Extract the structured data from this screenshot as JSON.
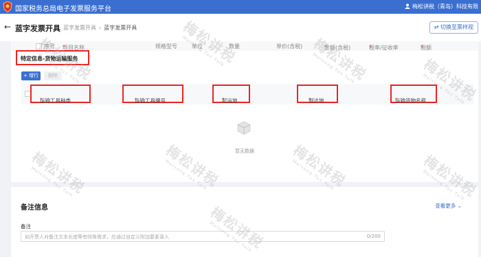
{
  "topbar": {
    "title": "国家税务总局电子发票服务平台",
    "user": "梅松讲税（青岛）科技有限"
  },
  "header": {
    "page_title": "蓝字发票开具",
    "breadcrumb": [
      "蓝字发票开具",
      "蓝字发票开具"
    ],
    "switch_button": "切换至票样视"
  },
  "table_header": {
    "columns": [
      "序号",
      "项目名称",
      "规格型号",
      "单位",
      "数量",
      "单价(含税)",
      "金额(含税)",
      "税率/征收率",
      "税额"
    ]
  },
  "special_info": {
    "title": "特定信息-货物运输服务"
  },
  "buttons": {
    "add": "+ 增行",
    "delete": "删除"
  },
  "transport_table": {
    "columns": [
      "运输工具种类",
      "运输工具牌号",
      "起运地",
      "到达地",
      "运输货物名称"
    ],
    "required_mark": "*",
    "empty_text": "暂无数据"
  },
  "remarks": {
    "title": "备注信息",
    "more": "查看更多",
    "label": "备注",
    "placeholder": "如开票人对备注文本长度等有特殊需求，应通过自定义附加要素录入",
    "counter": "0/200"
  },
  "watermark": {
    "text": "梅松讲税",
    "sub": "Meisong Tax Talk"
  },
  "colors": {
    "brand": "#3a6fd0",
    "highlight": "#e22222"
  },
  "icons": {
    "emblem": "tax-emblem-icon",
    "user": "user-icon",
    "back": "arrow-left-icon",
    "switch": "document-switch-icon",
    "empty": "empty-box-icon",
    "more": "chevron-down-icon"
  }
}
